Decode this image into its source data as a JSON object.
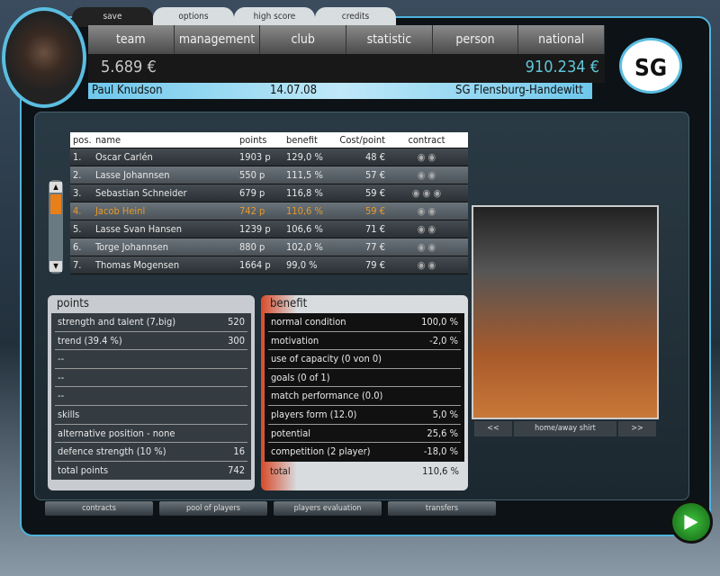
{
  "top_tabs": [
    "save",
    "options",
    "high score",
    "credits"
  ],
  "nav": [
    "team",
    "management",
    "club",
    "statistic",
    "person",
    "national"
  ],
  "cash": "5.689 €",
  "budget": "910.234 €",
  "manager": "Paul Knudson",
  "date": "14.07.08",
  "club": "SG Flensburg-Handewitt",
  "logo_text": "SG",
  "table": {
    "headers": [
      "pos.",
      "name",
      "points",
      "benefit",
      "Cost/point",
      "contract"
    ],
    "rows": [
      [
        "1.",
        "Oscar Carlén",
        "1903 p",
        "129,0 %",
        "48 €",
        2
      ],
      [
        "2.",
        "Lasse Johannsen",
        "550 p",
        "111,5 %",
        "57 €",
        2
      ],
      [
        "3.",
        "Sebastian Schneider",
        "679 p",
        "116,8 %",
        "59 €",
        3
      ],
      [
        "4.",
        "Jacob Heinl",
        "742 p",
        "110,6 %",
        "59 €",
        2
      ],
      [
        "5.",
        "Lasse Svan Hansen",
        "1239 p",
        "106,6 %",
        "71 €",
        2
      ],
      [
        "6.",
        "Torge Johannsen",
        "880 p",
        "102,0 %",
        "77 €",
        2
      ],
      [
        "7.",
        "Thomas Mogensen",
        "1664 p",
        "99,0 %",
        "79 €",
        2
      ]
    ],
    "selected_index": 3
  },
  "points": {
    "title": "points",
    "rows": [
      [
        "strength and talent (7,big)",
        "520"
      ],
      [
        "trend (39.4 %)",
        "300"
      ],
      [
        "--",
        ""
      ],
      [
        "--",
        ""
      ],
      [
        "--",
        ""
      ],
      [
        "skills",
        ""
      ],
      [
        "alternative position - none",
        ""
      ],
      [
        "defence strength (10 %)",
        "16"
      ],
      [
        "total points",
        "742"
      ]
    ]
  },
  "benefit": {
    "title": "benefit",
    "rows": [
      [
        "normal condition",
        "100,0 %"
      ],
      [
        "motivation",
        "-2,0 %"
      ],
      [
        "use of capacity (0 von 0)",
        ""
      ],
      [
        "goals (0 of 1)",
        ""
      ],
      [
        "match performance (0.0)",
        ""
      ],
      [
        "players form (12.0)",
        "5,0 %"
      ],
      [
        "potential",
        "25,6 %"
      ],
      [
        "competition (2 player)",
        "-18,0 %"
      ]
    ],
    "total_label": "total",
    "total_value": "110,6 %"
  },
  "photo_controls": [
    "<<",
    "home/away shirt",
    ">>"
  ],
  "bottom_buttons": [
    "contracts",
    "pool of players",
    "players evaluation",
    "transfers"
  ],
  "go_icon": "play-arrow"
}
